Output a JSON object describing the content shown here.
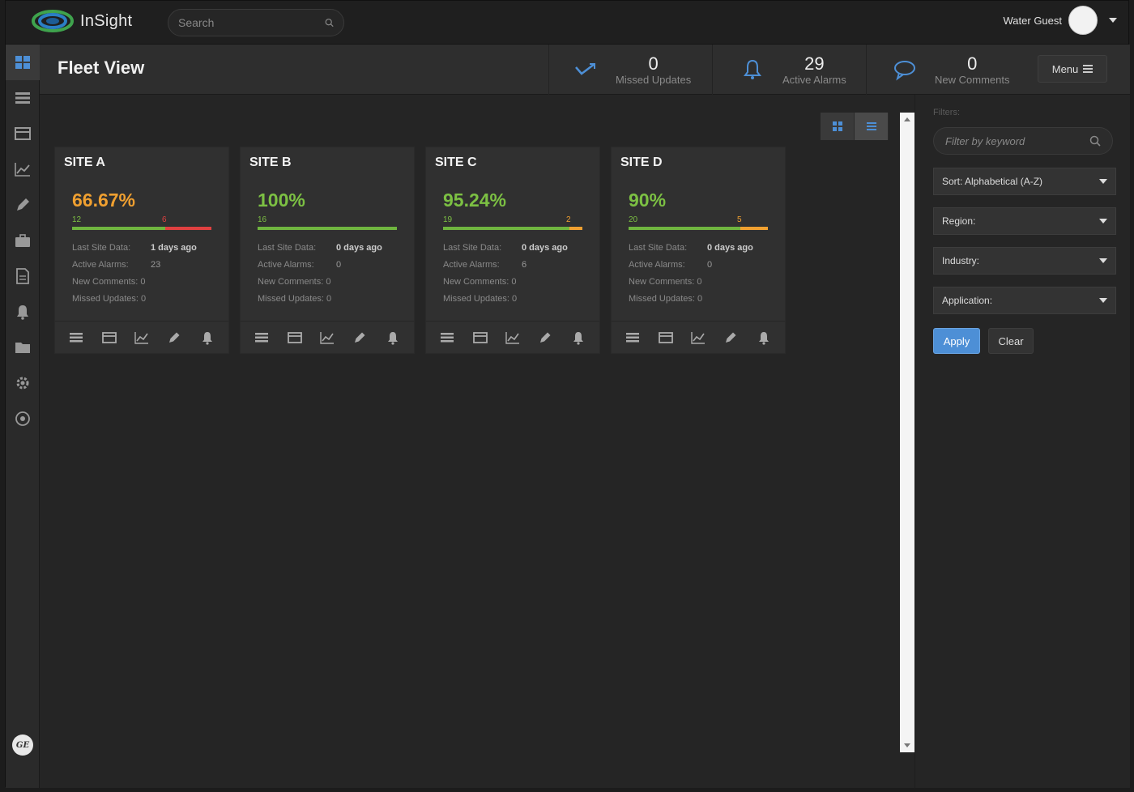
{
  "app": {
    "name": "InSight",
    "search_placeholder": "Search",
    "user_name": "Water Guest"
  },
  "header": {
    "title": "Fleet View",
    "stats": [
      {
        "value": "0",
        "label": "Missed Updates",
        "icon": "checkmark-trend-icon"
      },
      {
        "value": "29",
        "label": "Active Alarms",
        "icon": "bell-icon"
      },
      {
        "value": "0",
        "label": "New Comments",
        "icon": "comment-icon"
      }
    ],
    "menu_label": "Menu"
  },
  "sidebar": {
    "items": [
      {
        "name": "dashboard",
        "icon": "grid-icon"
      },
      {
        "name": "list",
        "icon": "list-icon"
      },
      {
        "name": "table",
        "icon": "table-icon"
      },
      {
        "name": "trends",
        "icon": "chart-icon"
      },
      {
        "name": "edit",
        "icon": "pencil-icon"
      },
      {
        "name": "assets",
        "icon": "briefcase-icon"
      },
      {
        "name": "reports",
        "icon": "document-icon"
      },
      {
        "name": "alarms",
        "icon": "bell-icon"
      },
      {
        "name": "files",
        "icon": "folder-icon"
      },
      {
        "name": "settings",
        "icon": "gear-icon"
      },
      {
        "name": "support",
        "icon": "target-icon"
      }
    ],
    "footer_logo": "GE"
  },
  "sites": [
    {
      "title": "SITE A",
      "pct": "66.67%",
      "pct_color": "#f0a030",
      "good": 12,
      "bad": 6,
      "good_label": "12",
      "bad_label": "6",
      "bad_color": "#e04040",
      "last_site_data_label": "Last Site Data:",
      "last_site_data": "1 days ago",
      "active_alarms_label": "Active Alarms:",
      "active_alarms": "23",
      "new_comments": "New Comments: 0",
      "missed_updates": "Missed Updates: 0"
    },
    {
      "title": "SITE B",
      "pct": "100%",
      "pct_color": "#7cc043",
      "good": 16,
      "bad": 0,
      "good_label": "16",
      "bad_label": "",
      "bad_color": "#f0a030",
      "last_site_data_label": "Last Site Data:",
      "last_site_data": "0 days ago",
      "active_alarms_label": "Active Alarms:",
      "active_alarms": "0",
      "new_comments": "New Comments: 0",
      "missed_updates": "Missed Updates: 0"
    },
    {
      "title": "SITE C",
      "pct": "95.24%",
      "pct_color": "#7cc043",
      "good": 19,
      "bad": 2,
      "good_label": "19",
      "bad_label": "2",
      "bad_color": "#f0a030",
      "last_site_data_label": "Last Site Data:",
      "last_site_data": "0 days ago",
      "active_alarms_label": "Active Alarms:",
      "active_alarms": "6",
      "new_comments": "New Comments: 0",
      "missed_updates": "Missed Updates: 0"
    },
    {
      "title": "SITE D",
      "pct": "90%",
      "pct_color": "#7cc043",
      "good": 20,
      "bad": 5,
      "good_label": "20",
      "bad_label": "5",
      "bad_color": "#f0a030",
      "last_site_data_label": "Last Site Data:",
      "last_site_data": "0 days ago",
      "active_alarms_label": "Active Alarms:",
      "active_alarms": "0",
      "new_comments": "New Comments: 0",
      "missed_updates": "Missed Updates: 0"
    }
  ],
  "filters": {
    "label": "Filters:",
    "keyword_placeholder": "Filter by keyword",
    "sort": "Sort: Alphabetical (A-Z)",
    "region": "Region:",
    "industry": "Industry:",
    "application": "Application:",
    "apply_label": "Apply",
    "clear_label": "Clear"
  },
  "colors": {
    "accent_blue": "#4d8fd6",
    "good_green": "#7cc043",
    "warn_orange": "#f0a030",
    "alarm_red": "#e04040"
  }
}
